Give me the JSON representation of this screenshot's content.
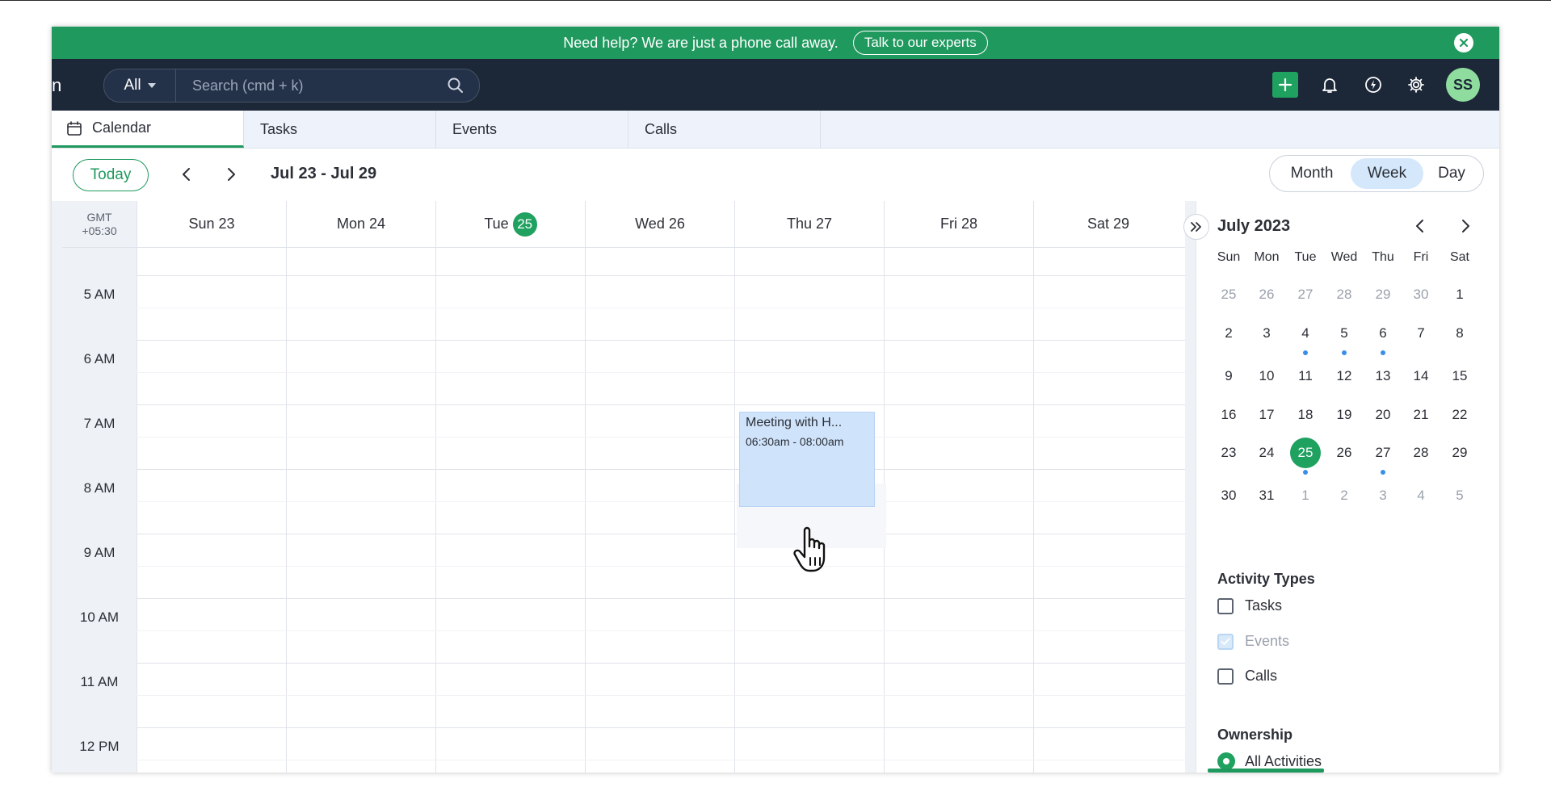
{
  "banner": {
    "message": "Need help? We are just a phone call away.",
    "cta_label": "Talk to our experts"
  },
  "nav": {
    "logo_fragment": "n",
    "search_scope": "All",
    "search_placeholder": "Search (cmd + k)",
    "avatar_initials": "SS",
    "accent_color": "#20995f"
  },
  "tabs": [
    {
      "label": "Calendar",
      "active": true
    },
    {
      "label": "Tasks",
      "active": false
    },
    {
      "label": "Events",
      "active": false
    },
    {
      "label": "Calls",
      "active": false
    }
  ],
  "toolbar": {
    "today_label": "Today",
    "range_label": "Jul 23 - Jul 29",
    "views": [
      "Month",
      "Week",
      "Day"
    ],
    "active_view": "Week"
  },
  "grid": {
    "timezone_line1": "GMT",
    "timezone_line2": "+05:30",
    "days": [
      {
        "label": "Sun 23"
      },
      {
        "label": "Mon 24"
      },
      {
        "label": "Tue",
        "badge": "25"
      },
      {
        "label": "Wed 26"
      },
      {
        "label": "Thu 27"
      },
      {
        "label": "Fri 28"
      },
      {
        "label": "Sat 29"
      }
    ],
    "hours": [
      "5 AM",
      "6 AM",
      "7 AM",
      "8 AM",
      "9 AM",
      "10 AM",
      "11 AM",
      "12 PM"
    ]
  },
  "event": {
    "title": "Meeting with H...",
    "time": "06:30am - 08:00am",
    "day": "Thu 27"
  },
  "mini_calendar": {
    "title": "July 2023",
    "dow": [
      "Sun",
      "Mon",
      "Tue",
      "Wed",
      "Thu",
      "Fri",
      "Sat"
    ],
    "weeks": [
      [
        "25",
        "26",
        "27",
        "28",
        "29",
        "30",
        "1"
      ],
      [
        "2",
        "3",
        "4",
        "5",
        "6",
        "7",
        "8"
      ],
      [
        "9",
        "10",
        "11",
        "12",
        "13",
        "14",
        "15"
      ],
      [
        "16",
        "17",
        "18",
        "19",
        "20",
        "21",
        "22"
      ],
      [
        "23",
        "24",
        "25",
        "26",
        "27",
        "28",
        "29"
      ],
      [
        "30",
        "31",
        "1",
        "2",
        "3",
        "4",
        "5"
      ]
    ],
    "muted_first_week_count": 6,
    "muted_last_week_from": 2,
    "selected": "25",
    "dots": [
      [
        1,
        2
      ],
      [
        1,
        3
      ],
      [
        1,
        4
      ],
      [
        4,
        2
      ],
      [
        4,
        4
      ]
    ]
  },
  "activity_types": {
    "title": "Activity Types",
    "items": [
      {
        "label": "Tasks",
        "checked": false,
        "disabled": false
      },
      {
        "label": "Events",
        "checked": true,
        "disabled": true
      },
      {
        "label": "Calls",
        "checked": false,
        "disabled": false
      }
    ]
  },
  "ownership": {
    "title": "Ownership",
    "selected": "All Activities"
  }
}
